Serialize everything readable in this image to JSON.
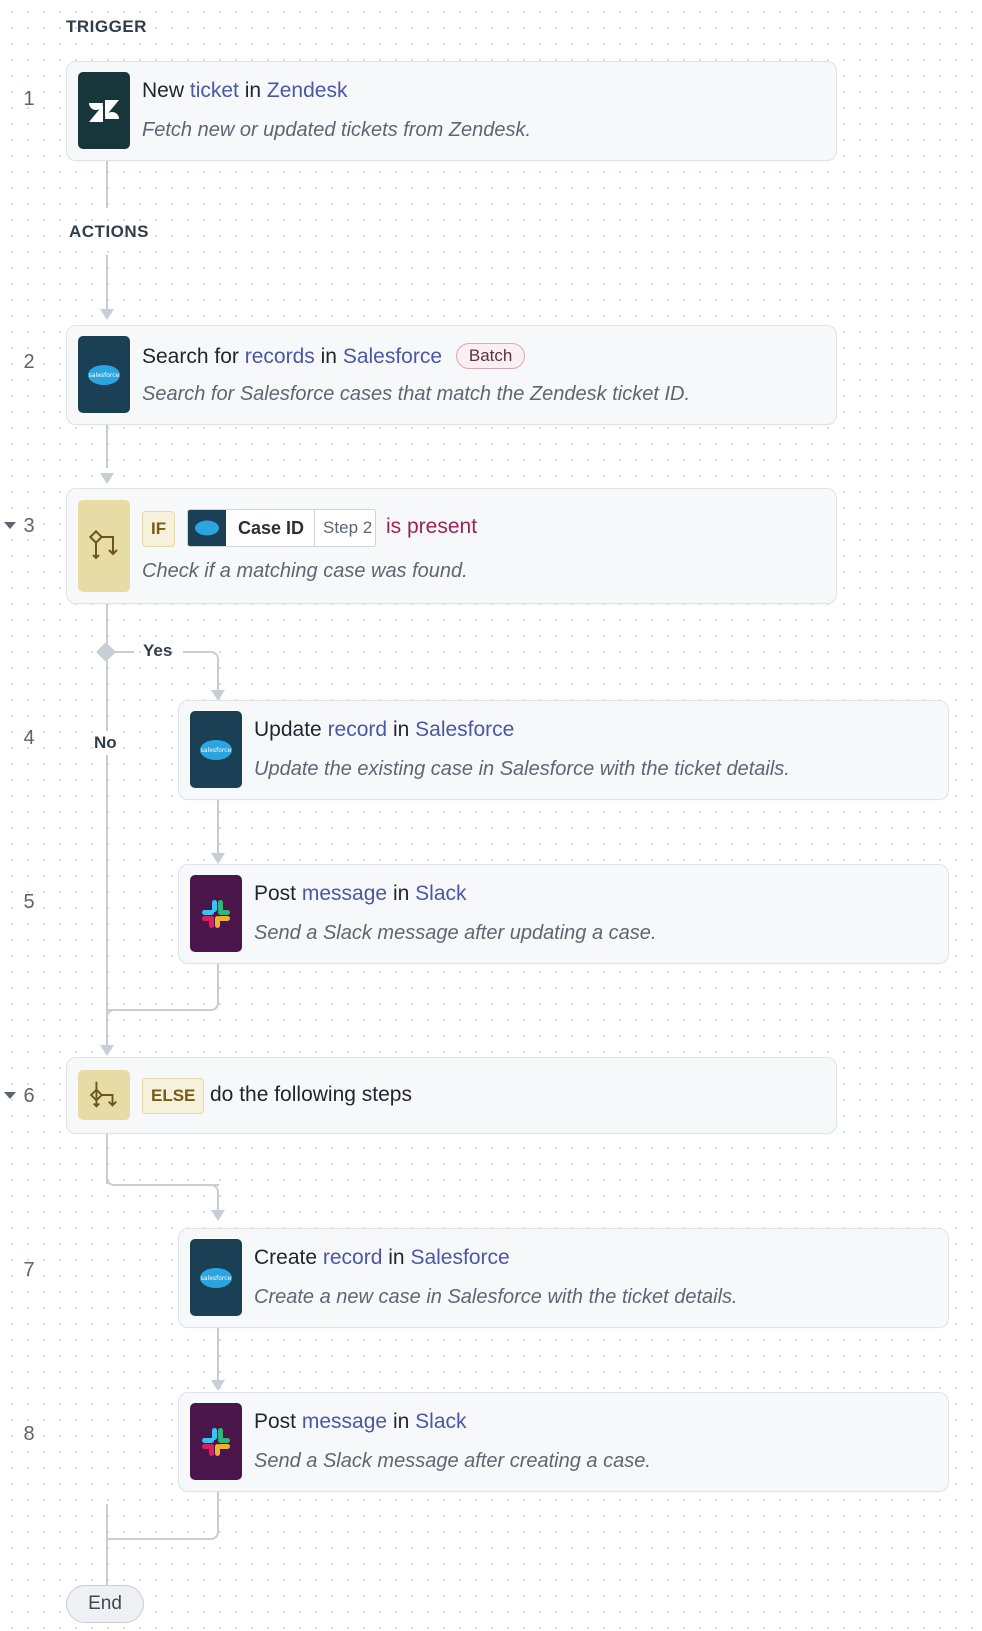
{
  "sections": {
    "trigger": "TRIGGER",
    "actions": "ACTIONS"
  },
  "step_numbers": [
    "1",
    "2",
    "3",
    "4",
    "5",
    "6",
    "7",
    "8"
  ],
  "steps": {
    "s1": {
      "verb": "New",
      "object": "ticket",
      "connector": "in",
      "app": "Zendesk",
      "description": "Fetch new or updated tickets from Zendesk."
    },
    "s2": {
      "verb": "Search for",
      "object": "records",
      "connector": "in",
      "app": "Salesforce",
      "badge": "Batch",
      "description": "Search for Salesforce cases that match the Zendesk ticket ID."
    },
    "s3": {
      "keyword": "IF",
      "field": "Case ID",
      "field_step": "Step 2",
      "condition": "is present",
      "description": "Check if a matching case was found."
    },
    "s4": {
      "verb": "Update",
      "object": "record",
      "connector": "in",
      "app": "Salesforce",
      "description": "Update the existing case in Salesforce with the ticket details."
    },
    "s5": {
      "verb": "Post",
      "object": "message",
      "connector": "in",
      "app": "Slack",
      "description": "Send a Slack message after updating a case."
    },
    "s6": {
      "keyword": "ELSE",
      "text": "do the following steps"
    },
    "s7": {
      "verb": "Create",
      "object": "record",
      "connector": "in",
      "app": "Salesforce",
      "description": "Create a new case in Salesforce with the ticket details."
    },
    "s8": {
      "verb": "Post",
      "object": "message",
      "connector": "in",
      "app": "Slack",
      "description": "Send a Slack message after creating a case."
    }
  },
  "branches": {
    "yes": "Yes",
    "no": "No"
  },
  "end_label": "End",
  "icon_text": {
    "salesforce": "salesforce"
  },
  "icons": {
    "zendesk": "zendesk-logo-icon",
    "salesforce": "salesforce-logo-icon",
    "slack": "slack-logo-icon",
    "if": "branch-if-icon",
    "else": "branch-else-icon"
  },
  "colors": {
    "zendesk_bg": "#17363b",
    "salesforce_bg": "#1b3f55",
    "slack_bg": "#4a154b",
    "condition_bg": "#e8dca6",
    "link": "#4b57a6",
    "condition_text": "#9b2452"
  }
}
